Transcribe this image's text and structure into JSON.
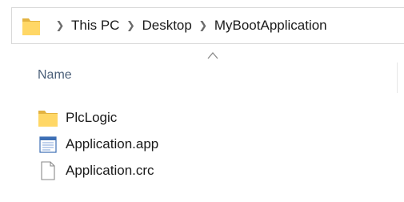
{
  "address_bar": {
    "folder_icon": "folder-icon",
    "separator_icon": "chevron-right-icon",
    "crumbs": [
      {
        "label": "This PC"
      },
      {
        "label": "Desktop"
      },
      {
        "label": "MyBootApplication"
      }
    ]
  },
  "list_header": {
    "sort_indicator": "sort-ascending-caret-icon",
    "name_column_label": "Name"
  },
  "files": [
    {
      "name": "PlcLogic",
      "icon": "folder-icon"
    },
    {
      "name": "Application.app",
      "icon": "app-file-icon"
    },
    {
      "name": "Application.crc",
      "icon": "blank-file-icon"
    }
  ],
  "colors": {
    "folder_yellow": "#FFD766",
    "folder_dark": "#E3B341",
    "header_text": "#4C607A",
    "border": "#D9D9D9",
    "app_icon_blue": "#3D6FB5"
  }
}
